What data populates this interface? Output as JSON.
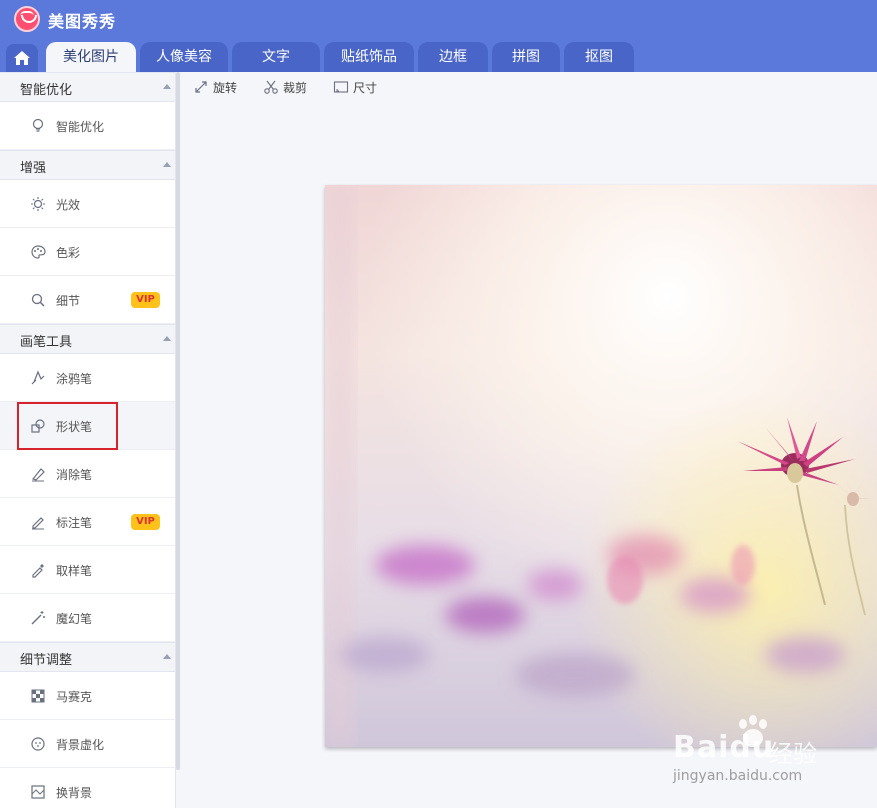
{
  "app": {
    "title": "美图秀秀"
  },
  "tabs": [
    {
      "label": "美化图片",
      "active": true
    },
    {
      "label": "人像美容"
    },
    {
      "label": "文字"
    },
    {
      "label": "贴纸饰品"
    },
    {
      "label": "边框"
    },
    {
      "label": "拼图"
    },
    {
      "label": "抠图"
    }
  ],
  "sidebar": {
    "sections": [
      {
        "title": "智能优化",
        "items": [
          {
            "label": "智能优化",
            "icon": "bulb-icon"
          }
        ]
      },
      {
        "title": "增强",
        "items": [
          {
            "label": "光效",
            "icon": "sun-icon"
          },
          {
            "label": "色彩",
            "icon": "palette-icon"
          },
          {
            "label": "细节",
            "icon": "magnifier-icon",
            "badge": "VIP"
          }
        ]
      },
      {
        "title": "画笔工具",
        "items": [
          {
            "label": "涂鸦笔",
            "icon": "doodle-brush-icon"
          },
          {
            "label": "形状笔",
            "icon": "shape-pen-icon",
            "highlighted": true
          },
          {
            "label": "消除笔",
            "icon": "eraser-pen-icon"
          },
          {
            "label": "标注笔",
            "icon": "marker-pen-icon",
            "badge": "VIP"
          },
          {
            "label": "取样笔",
            "icon": "eyedropper-icon"
          },
          {
            "label": "魔幻笔",
            "icon": "magic-wand-icon"
          }
        ]
      },
      {
        "title": "细节调整",
        "items": [
          {
            "label": "马赛克",
            "icon": "mosaic-icon"
          },
          {
            "label": "背景虚化",
            "icon": "blur-icon"
          },
          {
            "label": "换背景",
            "icon": "background-icon"
          }
        ]
      }
    ]
  },
  "toolbar": {
    "rotate": "旋转",
    "crop": "裁剪",
    "size": "尺寸"
  },
  "watermark": {
    "main": "Baidu",
    "jy": "经验",
    "sub": "jingyan.baidu.com"
  },
  "colors": {
    "brand": "#5b78db",
    "highlight": "#d6222a",
    "vip": "#ffc21a"
  }
}
